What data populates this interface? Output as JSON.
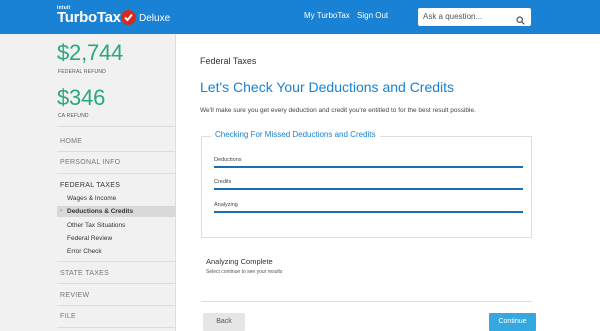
{
  "header": {
    "logo_parent": "intuit",
    "logo_brand": "TurboTax",
    "logo_edition": "Deluxe",
    "nav": [
      "My TurboTax",
      "Sign Out"
    ],
    "search_placeholder": "Ask a question...",
    "search_icon": "search-icon",
    "brand_color": "#1a82d4"
  },
  "sidebar": {
    "federal_refund": "$2,744",
    "federal_refund_label": "FEDERAL REFUND",
    "ca_refund": "$346",
    "ca_refund_label": "CA REFUND",
    "refund_color": "#2aa879",
    "items": {
      "home": "HOME",
      "personal_info": "PERSONAL INFO",
      "federal_taxes": "FEDERAL TAXES",
      "state_taxes": "STATE TAXES",
      "review": "REVIEW",
      "file": "FILE"
    },
    "federal_sub": [
      "Wages & Income",
      "Deductions & Credits",
      "Other Tax Situations",
      "Federal Review",
      "Error Check"
    ],
    "active_sub": "Deductions & Credits"
  },
  "main": {
    "breadcrumb": "Federal Taxes",
    "title": "Let's Check Your Deductions and Credits",
    "subtitle": "We'll make sure you get every deduction and credit you're entitled to for the best result possible.",
    "checking_box_title": "Checking For Missed Deductions and Credits",
    "progress": [
      {
        "label": "Deductions",
        "percent": 100
      },
      {
        "label": "Credits",
        "percent": 100
      },
      {
        "label": "Analyzing",
        "percent": 100
      }
    ],
    "complete_title": "Analyzing Complete",
    "complete_sub": "Select continue to see your results",
    "back_label": "Back",
    "continue_label": "Continue"
  }
}
